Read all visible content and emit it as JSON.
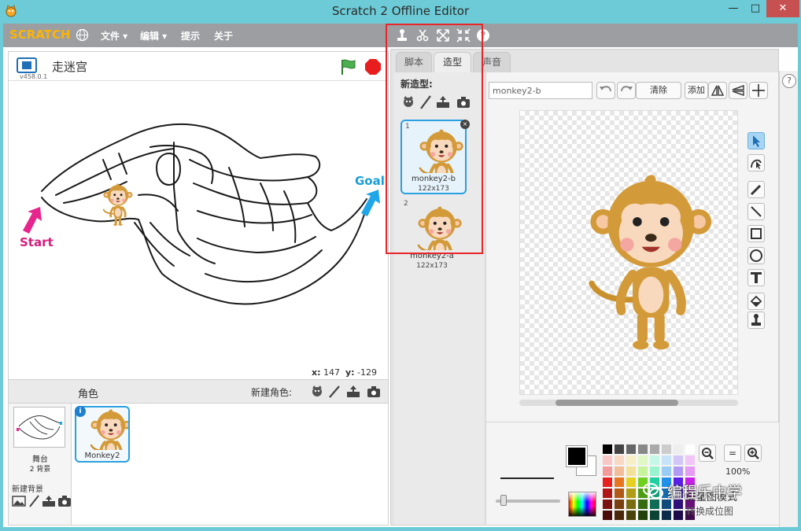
{
  "window": {
    "title": "Scratch 2 Offline Editor",
    "min": "—",
    "max": "□",
    "close": "✕"
  },
  "menubar": {
    "logo": "SCRATCH",
    "items": [
      {
        "label": "文件 ▾"
      },
      {
        "label": "编辑 ▾"
      },
      {
        "label": "提示"
      },
      {
        "label": "关于"
      }
    ],
    "help": "?"
  },
  "stage": {
    "version": "v458.0.1",
    "project_name": "走迷宫",
    "maze_labels": {
      "start": "Start",
      "goal": "Goal"
    },
    "coords": {
      "x_label": "x:",
      "x": "147",
      "y_label": "y:",
      "y": "-129"
    }
  },
  "sprites": {
    "title": "角色",
    "new_sprite_label": "新建角色:",
    "stage_label": "舞台",
    "backdrop_count": "2 背景",
    "new_backdrop_label": "新建背景",
    "sprite_list": [
      {
        "name": "Monkey2",
        "info": "i"
      }
    ]
  },
  "editor": {
    "tabs": [
      {
        "label": "脚本"
      },
      {
        "label": "造型"
      },
      {
        "label": "声音"
      }
    ],
    "new_costume_label": "新造型:",
    "costumes": [
      {
        "num": "1",
        "name": "monkey2-b",
        "size": "122x173",
        "close": "×"
      },
      {
        "num": "2",
        "name": "monkey2-a",
        "size": "122x173"
      }
    ],
    "paint": {
      "costume_name": "monkey2-b",
      "clear_label": "清除",
      "add_label": "添加",
      "zoom": "100%",
      "zoom_out": "−",
      "zoom_reset": "=",
      "zoom_in": "+",
      "mode_label": "矢量图模式",
      "convert_label": "转换成位图"
    }
  },
  "watermark": "编程乐中学",
  "colors": {
    "selection": "#2aa0e0",
    "highlight": "#e8262a",
    "menubar": "#9c9ea2"
  }
}
